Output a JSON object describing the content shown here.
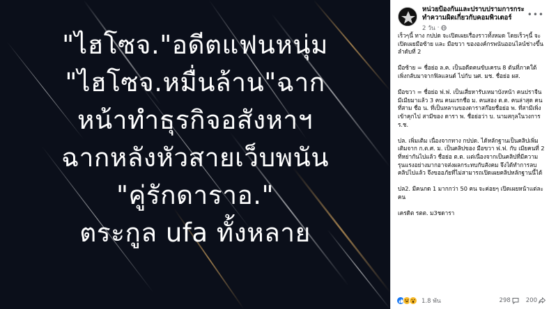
{
  "image": {
    "headline_lines": [
      "\"ไฮโซจ.\"อดีตแฟนหนุ่ม",
      "\"ไฮโซจ.หมื่นล้าน\"ฉาก",
      "หน้าทำธุรกิจอสังหาฯ",
      "ฉากหลังหัวสายเว็บพนัน",
      "\"คู่รักดาราอ.\"",
      "ตระกูล ufa ทั้งหลาย"
    ]
  },
  "post": {
    "page_name": "หน่วยป้องกันและปราบปรามการกระทำความผิดเกี่ยวกับคอมพิวเตอร์",
    "timestamp": "2 วัน",
    "body_paragraphs": [
      "เร็วๆนี้ ทาง กปปด จะเปิดเผยเรื่องราวทั้งหมด โดยเร็วๆนี้ จะเปิดเผยมือซ้าย และ มือขวา ขององค์กรพนันออนไลน์ช่างขึ้นลำดับที่ 2",
      "มือซ้าย = ชื่อย่อ ล.ค. เป็นอดีตคนขับเครน 8 ตันที่ภาคใต้ เพิ่งกลับมาจากฟิลแลนด์ ไปกับ นศ. มช. ชื่อย่อ ผส.",
      "มือขวา = ชื่อย่อ ฟ.ฟ. เป็นเสี่ยหารับเหมาบังหน้า คนปราจีน มีเมียมาแล้ว 3 คน คนแรกชื่อ ม. คนสอง ต.ต. คนล่าสุด คนที่สาม ชื่อ น. ที่เป็นหลานของดาราสก๊อยชื่อย่อ พ. ที่สามีเพิ่งเข้าคุกไป สามีของ ดารา พ. ชื่อย่อว่า บ. นามสกุลในวงการ ร.ช.",
      "ปล. เพิ่มเติม เนื่องจากทาง กปปด. ได้หลักฐานเป็นคลิปเพิ่มเติมจาก ก.ต.ศ. ม. เป็นคลิปของ มือขวา ฟ.ฟ. กับ เมียคนที่ 2 ที่หย่ากันไปแล้ว ชื่อย่อ ต.ต. แต่เนื่องจากเป็นคลิปที่มีความรุนแรงอย่างมากอาจส่งผลกระทบกับสังคม จึงได้ทำการลบคลิปไปแล้ว จึงขออภัยที่ไม่สามารถเปิดเผยคลิปหลักฐานนี้ได้",
      "ปล2. มีคนกด 1 มากกว่า 50 คน จะค่อยๆ เปิดเผยหน้าแต่ละคน",
      "เครดิต รตต. ม3ชดารา"
    ],
    "reactions_count": "1.8 พัน",
    "comments_count": "298",
    "shares_count": "200"
  },
  "colors": {
    "image_bg": "#0b0f1a",
    "like_blue": "#1877f2",
    "haha_yellow": "#f7b928"
  },
  "icons": [
    "globe-icon",
    "more-options-icon",
    "like-icon",
    "haha-icon",
    "wow-icon",
    "comment-icon",
    "share-icon"
  ]
}
